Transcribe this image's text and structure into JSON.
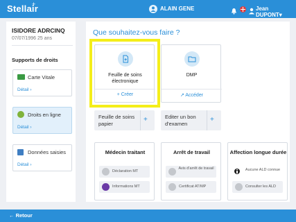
{
  "header": {
    "brand": "Stellair",
    "brand_plus": "+",
    "doctor_name": "ALAIN GENE",
    "user_name": "Jean DUPONT",
    "user_caret": "▾",
    "bell_icon": "bell-icon",
    "flag_icon": "swiss-flag-icon",
    "user_icon": "user-icon"
  },
  "patient": {
    "name": "ISIDORE ADRCINQ",
    "dob": "07/07/1996 25 ans"
  },
  "rights": {
    "title": "Supports de droits",
    "items": [
      {
        "label": "Carte Vitale",
        "detail": "Détail ›",
        "icon": "carte-vitale-icon",
        "active": false
      },
      {
        "label": "Droits en ligne",
        "detail": "Détail ›",
        "icon": "droits-en-ligne-icon",
        "active": true
      },
      {
        "label": "Données saisies",
        "detail": "Détail ›",
        "icon": "edit-icon",
        "active": false
      }
    ]
  },
  "main": {
    "title": "Que souhaitez-vous faire ?",
    "tiles": [
      {
        "title": "Feuille de soins électronique",
        "action": "+ Créer",
        "icon": "document-icon"
      },
      {
        "title": "DMP",
        "action": "↗ Accéder",
        "icon": "folder-icon"
      }
    ],
    "pills": [
      {
        "label": "Feuille de soins papier",
        "plus": "+"
      },
      {
        "label": "Editer un bon d'examen",
        "plus": "+"
      }
    ],
    "boxes": [
      {
        "title": "Médecin traitant",
        "buttons": [
          "Déclaration MT",
          "Informations MT"
        ]
      },
      {
        "title": "Arrêt de travail",
        "buttons": [
          "Avis d'arrêt de travail",
          "Certificat AT/MP"
        ]
      },
      {
        "title": "Affection longue durée",
        "info": "Aucune ALD connue",
        "button": "Consulter les ALD"
      }
    ]
  },
  "footer": {
    "back_label": "← Retour"
  },
  "colors": {
    "brand_blue": "#2a8fd8",
    "highlight": "#f4ee1a",
    "background": "#eef0f4"
  }
}
